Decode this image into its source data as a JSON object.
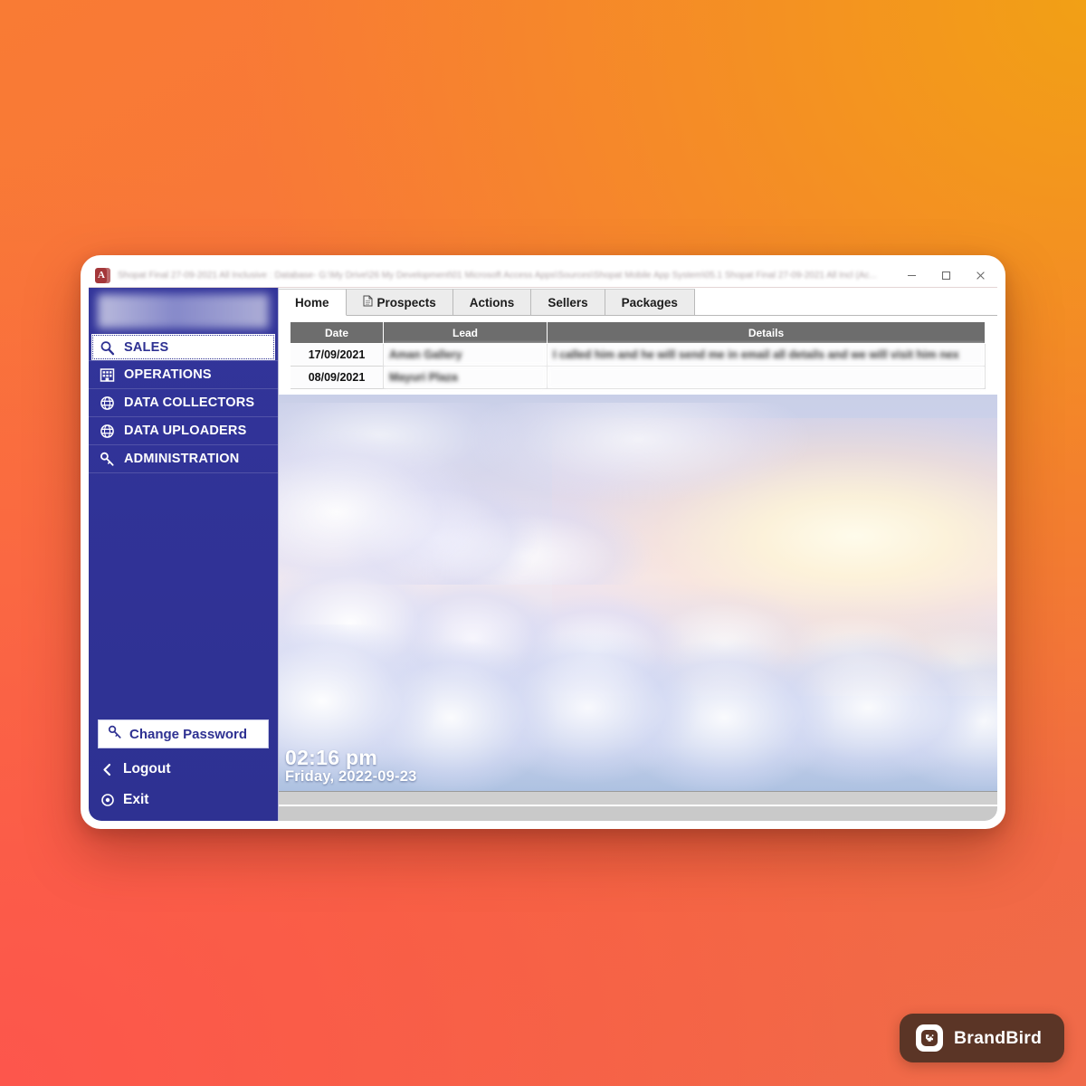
{
  "window": {
    "title": "Shopat Final 27-09-2021 All Inclusive : Database- G:\\My Drive\\26 My Development\\01 Microsoft Access Apps\\Sources\\Shopat Mobile App System\\05.1 Shopat Final 27-09-2021 All Incl (Ac...",
    "app_icon": "access-icon",
    "app_icon_glyph": "A",
    "controls": {
      "minimize": "minimize-icon",
      "maximize": "maximize-icon",
      "close": "close-icon"
    }
  },
  "sidebar": {
    "brand_logo": "shopex-logo",
    "items": [
      {
        "label": "SALES",
        "icon": "magnifier-icon",
        "selected": true
      },
      {
        "label": "OPERATIONS",
        "icon": "building-icon",
        "selected": false
      },
      {
        "label": "DATA COLLECTORS",
        "icon": "globe-icon",
        "selected": false
      },
      {
        "label": "DATA UPLOADERS",
        "icon": "globe-icon",
        "selected": false
      },
      {
        "label": "ADMINISTRATION",
        "icon": "key-icon",
        "selected": false
      }
    ],
    "change_password": {
      "label": "Change Password",
      "icon": "key-icon"
    },
    "logout": {
      "label": "Logout",
      "icon": "chevron-left-icon"
    },
    "exit": {
      "label": "Exit",
      "icon": "power-icon"
    }
  },
  "tabs": [
    {
      "label": "Home",
      "icon": null,
      "active": true
    },
    {
      "label": "Prospects",
      "icon": "document-icon",
      "active": false
    },
    {
      "label": "Actions",
      "icon": null,
      "active": false
    },
    {
      "label": "Sellers",
      "icon": null,
      "active": false
    },
    {
      "label": "Packages",
      "icon": null,
      "active": false
    }
  ],
  "table": {
    "columns": [
      "Date",
      "Lead",
      "Details"
    ],
    "rows": [
      {
        "date": "17/09/2021",
        "lead": "Aman Gallery",
        "lead_redacted": true,
        "details": "I called him and he will send me in email all details and we will visit him nex",
        "details_redacted": true
      },
      {
        "date": "08/09/2021",
        "lead": "Mayuri Plaza",
        "lead_redacted": true,
        "details": "",
        "details_redacted": true
      }
    ]
  },
  "clock": {
    "time": "02:16 pm",
    "date": "Friday, 2022-09-23"
  },
  "watermark": {
    "label": "BrandBird",
    "icon": "brandbird-logo-icon"
  },
  "colors": {
    "sidebar_blue": "#2e3192",
    "header_gray": "#6d6d6d",
    "backdrop_orange": "#f97b34",
    "backdrop_amber": "#f2a015",
    "backdrop_coral": "#fd564c",
    "access_red": "#a4373a",
    "watermark_brown": "#5b3526"
  }
}
